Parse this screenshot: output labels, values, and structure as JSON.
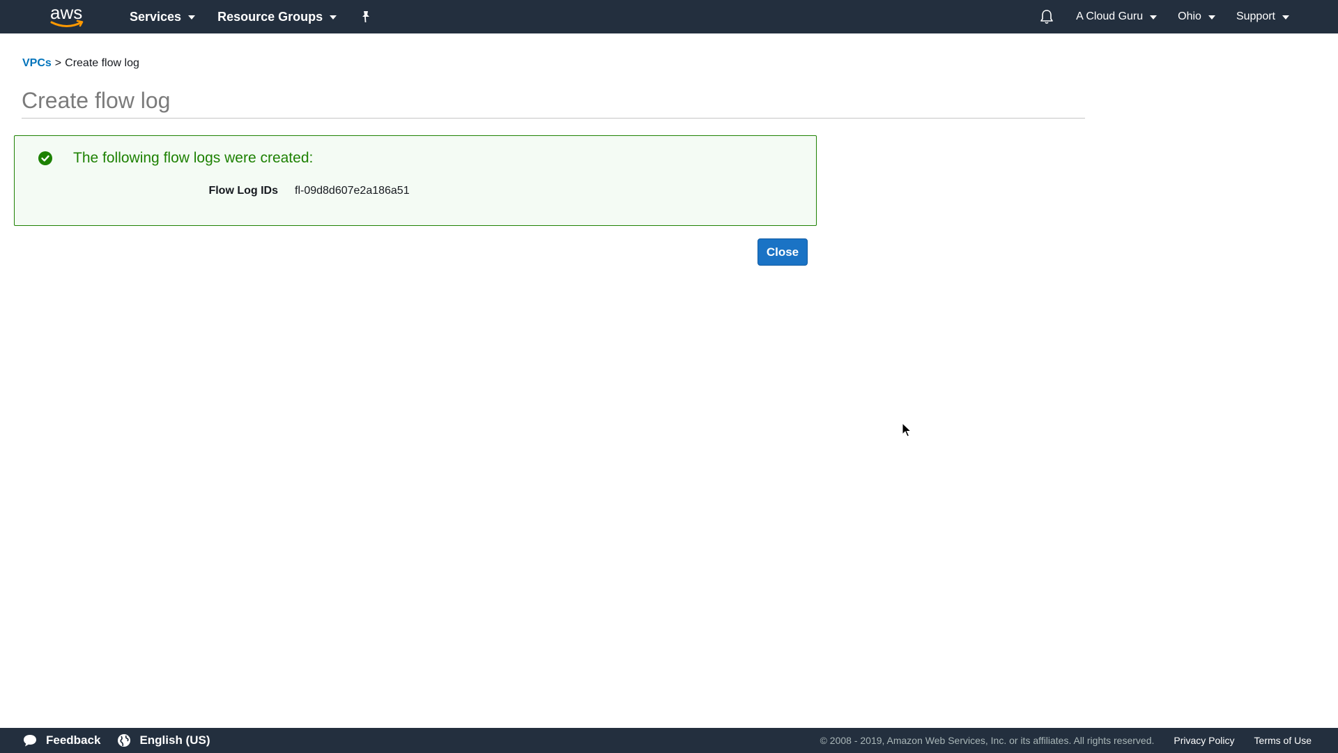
{
  "topnav": {
    "logo_text": "aws",
    "services_label": "Services",
    "resource_groups_label": "Resource Groups",
    "account_label": "A Cloud Guru",
    "region_label": "Ohio",
    "support_label": "Support"
  },
  "breadcrumb": {
    "parent": "VPCs",
    "separator": ">",
    "current": "Create flow log"
  },
  "page": {
    "title": "Create flow log"
  },
  "alert": {
    "title": "The following flow logs were created:",
    "label": "Flow Log IDs",
    "value": "fl-09d8d607e2a186a51"
  },
  "actions": {
    "close_label": "Close"
  },
  "footer": {
    "feedback_label": "Feedback",
    "language_label": "English (US)",
    "copyright": "© 2008 - 2019, Amazon Web Services, Inc. or its affiliates. All rights reserved.",
    "privacy_label": "Privacy Policy",
    "terms_label": "Terms of Use"
  },
  "colors": {
    "nav_bg": "#232f3e",
    "success": "#1d8102",
    "link": "#0073bb",
    "primary_button": "#1a73c5",
    "aws_smile": "#ff9900"
  }
}
